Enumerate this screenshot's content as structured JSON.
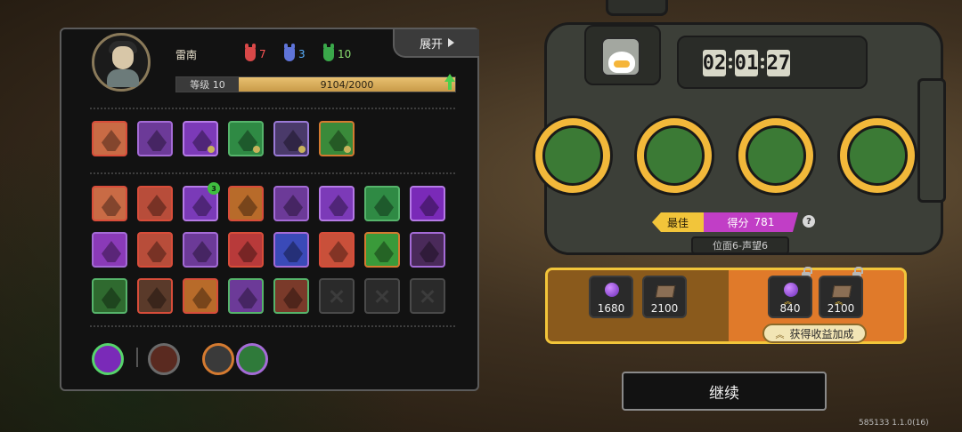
{
  "player": {
    "name": "雷南",
    "level_label": "等级 10",
    "xp_text": "9104/2000",
    "stats": {
      "red": "7",
      "blue": "3",
      "green": "10"
    }
  },
  "header": {
    "expand_label": "展开"
  },
  "equipped": [
    {
      "name": "ability-slot-1",
      "bg": "#c96b45",
      "border": "#d84d3a"
    },
    {
      "name": "ability-slot-2",
      "bg": "#6c3a98",
      "border": "#a46bd6"
    },
    {
      "name": "ability-slot-3",
      "bg": "#7c3ab8",
      "border": "#b57ae6"
    },
    {
      "name": "ability-slot-4",
      "bg": "#2f8a44",
      "border": "#56b46b"
    },
    {
      "name": "ability-slot-5",
      "bg": "#4a3a6a",
      "border": "#9a7ad6"
    },
    {
      "name": "ability-slot-6",
      "bg": "#3a8a3a",
      "border": "#d47a30"
    }
  ],
  "inventory_rows": [
    [
      {
        "name": "upgrade-claw",
        "bg": "#c96b45",
        "border": "#d84d3a"
      },
      {
        "name": "upgrade-spears",
        "bg": "#b84d3a",
        "border": "#d84d3a"
      },
      {
        "name": "upgrade-orb",
        "bg": "#7a3ab8",
        "border": "#b57ae6",
        "badge": "3"
      },
      {
        "name": "upgrade-gate",
        "bg": "#b86b2a",
        "border": "#d84d3a"
      },
      {
        "name": "upgrade-staff",
        "bg": "#6c3a98",
        "border": "#a46bd6"
      },
      {
        "name": "upgrade-squid",
        "bg": "#7c3ab8",
        "border": "#b57ae6"
      },
      {
        "name": "upgrade-arrow",
        "bg": "#2f8a44",
        "border": "#56b46b"
      },
      {
        "name": "upgrade-crescent",
        "bg": "#7a2ab8",
        "border": "#b57ae6"
      }
    ],
    [
      {
        "name": "upgrade-web",
        "bg": "#8a3ab8",
        "border": "#a46bd6"
      },
      {
        "name": "upgrade-horn",
        "bg": "#b84d3a",
        "border": "#d84d3a"
      },
      {
        "name": "upgrade-wings",
        "bg": "#6c3a98",
        "border": "#a46bd6"
      },
      {
        "name": "upgrade-warrior",
        "bg": "#b83a3a",
        "border": "#d84d3a"
      },
      {
        "name": "upgrade-blade",
        "bg": "#3a4ab8",
        "border": "#a46bd6"
      },
      {
        "name": "upgrade-fire",
        "bg": "#c9503a",
        "border": "#d84d3a"
      },
      {
        "name": "upgrade-trees",
        "bg": "#3a9a3a",
        "border": "#d47a30"
      },
      {
        "name": "upgrade-scroll",
        "bg": "#4a2a5a",
        "border": "#a46bd6"
      }
    ],
    [
      {
        "name": "upgrade-leaf",
        "bg": "#2f6a2f",
        "border": "#56b46b"
      },
      {
        "name": "upgrade-shield",
        "bg": "#5a3a2a",
        "border": "#d84d3a"
      },
      {
        "name": "upgrade-crown",
        "bg": "#b86b2a",
        "border": "#d84d3a"
      },
      {
        "name": "upgrade-cross",
        "bg": "#6c3a98",
        "border": "#56b46b"
      },
      {
        "name": "upgrade-beast",
        "bg": "#7a3a2a",
        "border": "#56b46b"
      },
      {
        "name": "empty-slot",
        "empty": true
      },
      {
        "name": "empty-slot",
        "empty": true
      },
      {
        "name": "empty-slot",
        "empty": true
      }
    ]
  ],
  "bottom_icons": [
    {
      "name": "vortex-icon",
      "bg": "#7a2ab8",
      "ring": "#56d46b"
    },
    {
      "name": "slash-icon",
      "bg": "#5a2a20",
      "ring": "#6a6a6a"
    },
    {
      "name": "swords-icon",
      "bg": "#3a3a3a",
      "ring": "#d47a30"
    },
    {
      "name": "shield-icon",
      "bg": "#2f7a3a",
      "ring": "#a46bd6"
    }
  ],
  "timer": {
    "h": "02",
    "m": "01",
    "s": "27"
  },
  "team": [
    {
      "name": "team-member-1",
      "inner": "#3b7a35"
    },
    {
      "name": "team-member-2",
      "inner": "#3b7a35"
    },
    {
      "name": "team-member-3",
      "inner": "#3b7a35"
    },
    {
      "name": "team-member-4",
      "inner": "#3b7a35"
    }
  ],
  "score": {
    "best_label": "最佳",
    "score_label": "得分",
    "score_value": "781",
    "help": "?"
  },
  "location_text": "位面6-声望6",
  "rewards": {
    "base": [
      {
        "name": "purple-orb-reward",
        "value": "1680",
        "icon": "orb"
      },
      {
        "name": "slab-reward",
        "value": "2100",
        "icon": "slab"
      }
    ],
    "bonus": [
      {
        "name": "bonus-orb-reward",
        "value": "840",
        "icon": "orb"
      },
      {
        "name": "bonus-slab-reward",
        "value": "2100",
        "icon": "slab"
      }
    ],
    "bonus_label": "获得收益加成"
  },
  "continue_label": "继续",
  "version": "585133 1.1.0(16)"
}
